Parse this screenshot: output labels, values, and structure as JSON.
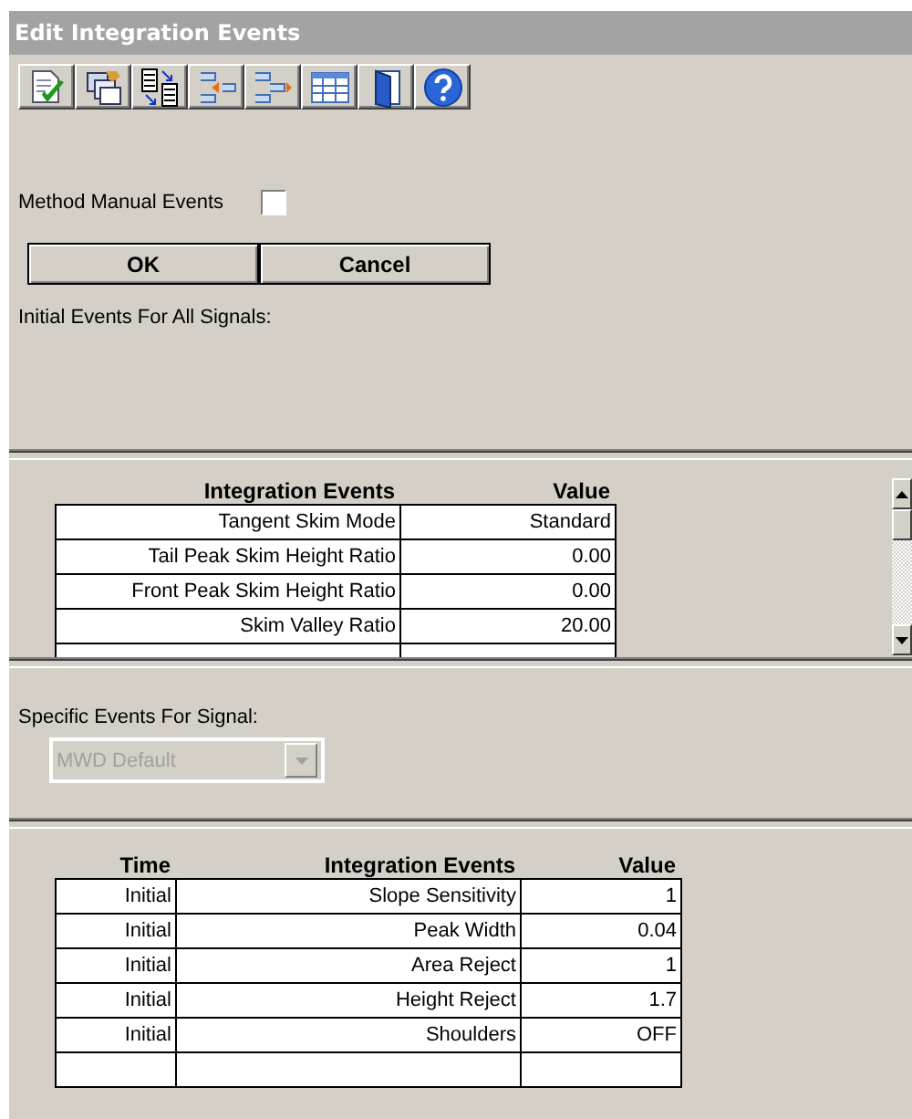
{
  "window": {
    "title": "Edit Integration Events"
  },
  "toolbar": [
    {
      "kind": "check_doc"
    },
    {
      "kind": "copy"
    },
    {
      "kind": "transfer"
    },
    {
      "kind": "collapse"
    },
    {
      "kind": "expand"
    },
    {
      "kind": "grid"
    },
    {
      "kind": "exit"
    },
    {
      "kind": "help"
    }
  ],
  "method_manual_events": {
    "label": "Method Manual Events",
    "checked": false
  },
  "buttons": [
    {
      "label": "OK"
    },
    {
      "label": "Cancel"
    }
  ],
  "initial_events_label": "Initial Events For All Signals:",
  "initial_table": {
    "columns": [
      "Integration Events",
      "Value"
    ],
    "rows": [
      [
        "Tangent Skim Mode",
        "Standard"
      ],
      [
        "Tail Peak Skim Height Ratio",
        "0.00"
      ],
      [
        "Front Peak Skim Height Ratio",
        "0.00"
      ],
      [
        "Skim Valley Ratio",
        "20.00"
      ]
    ]
  },
  "specific_events_label": "Specific Events For Signal:",
  "signal_dropdown": {
    "value": "MWD Default",
    "disabled": true
  },
  "specific_table": {
    "columns": [
      "Time",
      "Integration Events",
      "Value"
    ],
    "rows": [
      [
        "Initial",
        "Slope Sensitivity",
        "1"
      ],
      [
        "Initial",
        "Peak Width",
        "0.04"
      ],
      [
        "Initial",
        "Area Reject",
        "1"
      ],
      [
        "Initial",
        "Height Reject",
        "1.7"
      ],
      [
        "Initial",
        "Shoulders",
        "OFF"
      ]
    ]
  }
}
